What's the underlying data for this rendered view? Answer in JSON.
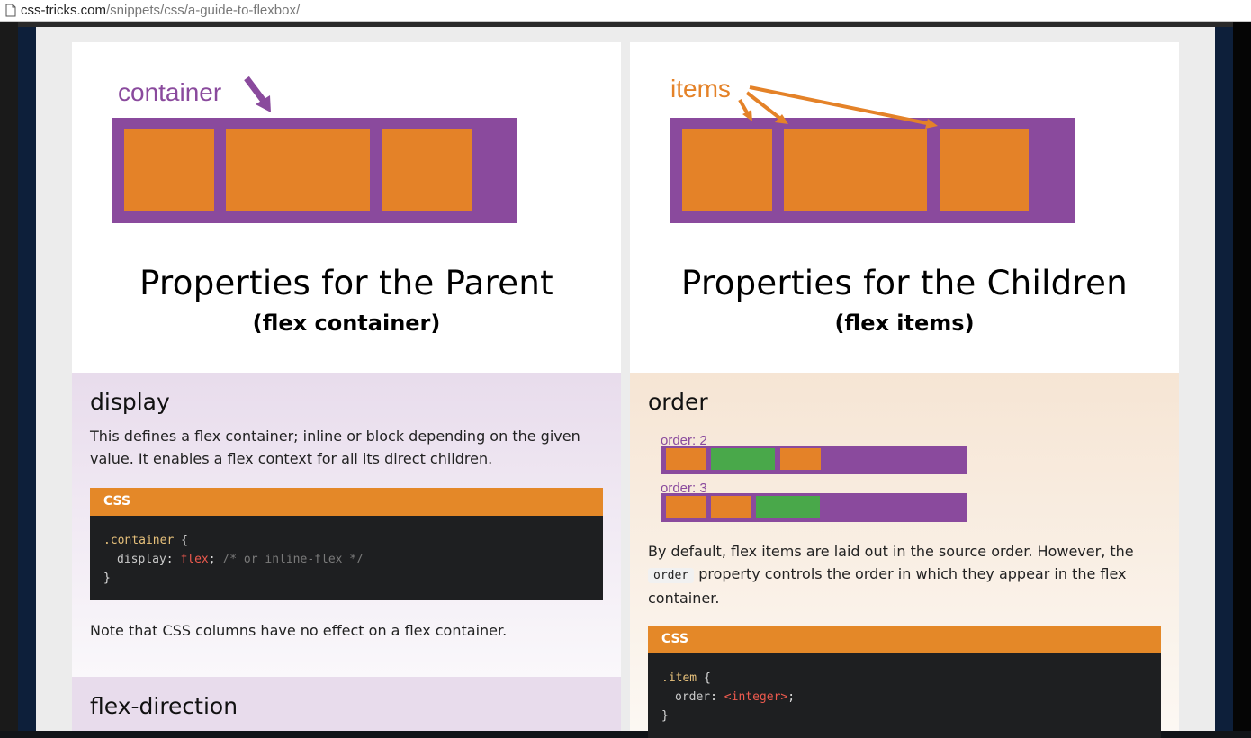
{
  "browser": {
    "url_host": "css-tricks.com",
    "url_path": "/snippets/css/a-guide-to-flexbox/"
  },
  "colors": {
    "purple": "#8a4a9d",
    "orange": "#e48228",
    "green": "#49a84a",
    "code_header": "#e48828",
    "code_bg": "#1e1f21"
  },
  "parent": {
    "diagram_label": "container",
    "title": "Properties for the Parent",
    "subtitle": "(flex container)",
    "display": {
      "heading": "display",
      "description": "This defines a flex container; inline or block depending on the given value. It enables a flex context for all its direct children.",
      "code_lang": "CSS",
      "code_selector": ".container",
      "code_open": " {",
      "code_prop": "display",
      "code_colon": ": ",
      "code_value": "flex",
      "code_semi": ";",
      "code_comment": " /* or inline-flex */",
      "code_close": "}",
      "note": "Note that CSS columns have no effect on a flex container."
    },
    "next_heading": "flex-direction"
  },
  "children": {
    "diagram_label": "items",
    "title": "Properties for the Children",
    "subtitle": "(flex items)",
    "order": {
      "heading": "order",
      "example1_label": "order: 2",
      "example2_label": "order: 3",
      "desc_before": "By default, flex items are laid out in the source order. However, the",
      "desc_code": "order",
      "desc_after": " property controls the order in which they appear in the flex container.",
      "code_lang": "CSS",
      "code_selector": ".item",
      "code_open": " {",
      "code_prop": "order",
      "code_colon": ": ",
      "code_value": "<integer>",
      "code_semi": ";",
      "code_close": "}"
    }
  }
}
